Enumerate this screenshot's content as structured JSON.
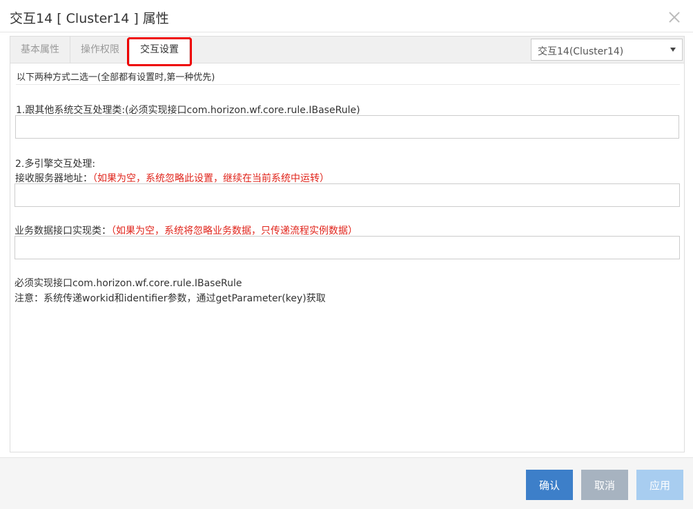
{
  "dialog": {
    "title": "交互14 [ Cluster14 ] 属性"
  },
  "tabs": [
    {
      "label": "基本属性"
    },
    {
      "label": "操作权限"
    },
    {
      "label": "交互设置"
    }
  ],
  "node_select": {
    "value": "交互14(Cluster14)"
  },
  "content": {
    "intro": "以下两种方式二选一(全部都有设置时,第一种优先)",
    "section1_label": "1.跟其他系统交互处理类:(必须实现接口com.horizon.wf.core.rule.IBaseRule)",
    "section1_value": "",
    "section2_label": "2.多引擎交互处理:",
    "server_label": "接收服务器地址：",
    "server_hint": "（如果为空，系统忽略此设置，继续在当前系统中运转）",
    "server_value": "",
    "impl_label": "业务数据接口实现类：",
    "impl_hint": "（如果为空，系统将忽略业务数据，只传递流程实例数据）",
    "impl_value": "",
    "note1": "必须实现接口com.horizon.wf.core.rule.IBaseRule",
    "note2": "注意：系统传递workid和identifier参数，通过getParameter(key)获取"
  },
  "footer": {
    "confirm_label": "确认",
    "cancel_label": "取消",
    "apply_label": "应用"
  },
  "colors": {
    "primary": "#3d7fc9",
    "cancel": "#a7b3c0",
    "apply_disabled": "#a8cdf0",
    "hint_red": "#e0241b",
    "highlight_box": "#ee0000"
  }
}
